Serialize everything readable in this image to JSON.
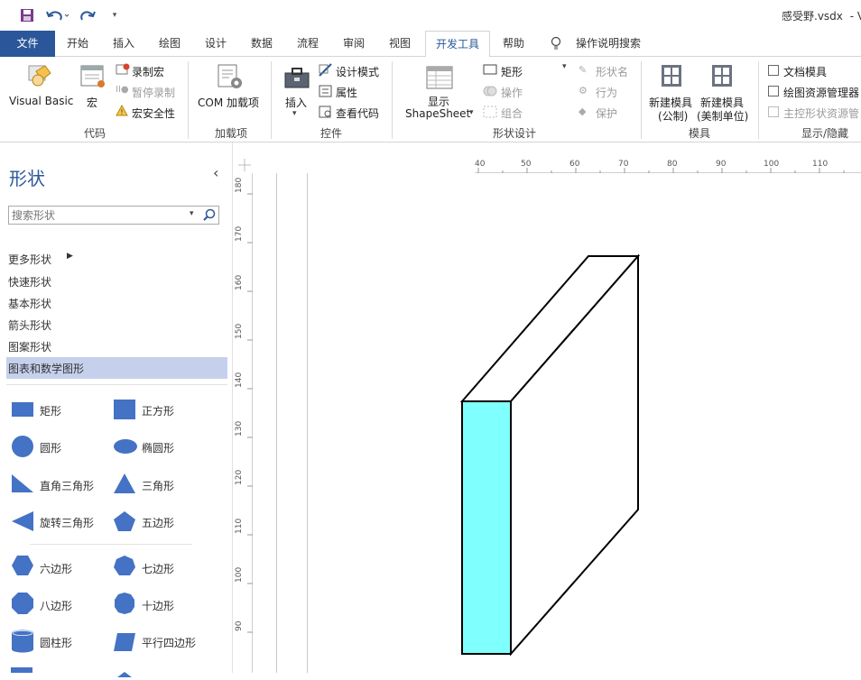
{
  "window": {
    "filename": "感受野.vsdx",
    "title_suffix": "-  V"
  },
  "quick_access": [
    "save-icon",
    "undo-icon",
    "redo-icon",
    "customize-icon"
  ],
  "tabs": [
    {
      "label": "文件",
      "kind": "file"
    },
    {
      "label": "开始"
    },
    {
      "label": "插入"
    },
    {
      "label": "绘图"
    },
    {
      "label": "设计"
    },
    {
      "label": "数据"
    },
    {
      "label": "流程"
    },
    {
      "label": "审阅"
    },
    {
      "label": "视图"
    },
    {
      "label": "开发工具",
      "active": true
    },
    {
      "label": "帮助"
    }
  ],
  "tell_me": "操作说明搜索",
  "ribbon": {
    "code": {
      "label": "代码",
      "visual_basic": "Visual Basic",
      "macro": "宏",
      "record_macro": "录制宏",
      "pause_record": "暂停录制",
      "macro_security": "宏安全性"
    },
    "addins": {
      "label": "加载项",
      "com": "COM 加载项"
    },
    "controls": {
      "label": "控件",
      "insert": "插入",
      "design_mode": "设计模式",
      "properties": "属性",
      "view_code": "查看代码"
    },
    "shape_design": {
      "label": "形状设计",
      "show": "显示",
      "shapesheet": "ShapeSheet",
      "rectangle": "矩形",
      "operations": "操作",
      "group": "组合",
      "shape_name": "形状名",
      "behavior": "行为",
      "protect": "保护"
    },
    "stencil": {
      "label": "模具",
      "new_metric": "新建模具",
      "metric": "(公制)",
      "new_us": "新建模具",
      "us": "(美制单位)"
    },
    "show_hide": {
      "label": "显示/隐藏",
      "doc_stencil": "文档模具",
      "drawing_explorer": "绘图资源管理器",
      "master_explorer": "主控形状资源管"
    }
  },
  "panel": {
    "title": "形状",
    "search_placeholder": "搜索形状",
    "more_shapes": "更多形状",
    "categories": [
      "快速形状",
      "基本形状",
      "箭头形状",
      "图案形状",
      "图表和数学图形"
    ],
    "selected_category": "图表和数学图形",
    "shapes": [
      "矩形",
      "正方形",
      "圆形",
      "椭圆形",
      "直角三角形",
      "三角形",
      "旋转三角形",
      "五边形",
      "六边形",
      "七边形",
      "八边形",
      "十边形",
      "圆柱形",
      "平行四边形"
    ]
  },
  "ruler": {
    "h_ticks": [
      "40",
      "50",
      "60",
      "70",
      "80",
      "90",
      "100",
      "110"
    ],
    "v_ticks": [
      "180",
      "170",
      "160",
      "150",
      "140",
      "130",
      "120",
      "110",
      "100",
      "90"
    ]
  },
  "colors": {
    "accent": "#2b579a",
    "shape_fill": "#4472c4",
    "box_face": "#80ffff",
    "selected": "#c5d1ec"
  }
}
